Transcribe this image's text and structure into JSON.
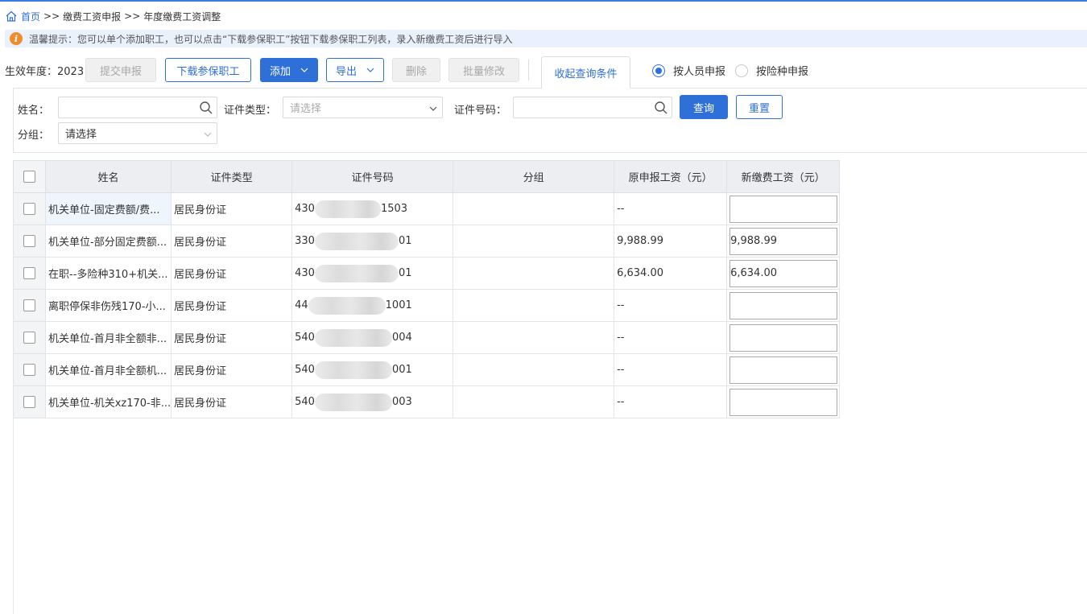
{
  "breadcrumb": {
    "home": "首页",
    "sep1": ">>",
    "level1": "缴费工资申报",
    "sep2": ">>",
    "current": "年度缴费工资调整"
  },
  "tip": {
    "text": "温馨提示：您可以单个添加职工，也可以点击“下载参保职工”按钮下载参保职工列表，录入新缴费工资后进行导入"
  },
  "toolbar": {
    "year_label": "生效年度：",
    "year_value": "2023",
    "submit_label": "提交申报",
    "download_label": "下载参保职工",
    "add_label": "添加",
    "export_label": "导出",
    "delete_label": "删除",
    "batch_edit_label": "批量修改",
    "collapse_label": "收起查询条件",
    "radio_by_person": "按人员申报",
    "radio_by_insurance": "按险种申报",
    "selected_mode": "by_person"
  },
  "query": {
    "name_label": "姓名：",
    "name_value": "",
    "id_type_label": "证件类型：",
    "id_type_placeholder": "请选择",
    "id_no_label": "证件号码：",
    "id_no_value": "",
    "search_label": "查询",
    "reset_label": "重置",
    "group_label": "分组：",
    "group_value": "请选择"
  },
  "table": {
    "columns": [
      "姓名",
      "证件类型",
      "证件号码",
      "分组",
      "原申报工资（元）",
      "新缴费工资（元）"
    ],
    "rows": [
      {
        "name": "机关单位-固定费额/费...",
        "id_type": "居民身份证",
        "id_prefix": "430",
        "id_suffix": "1503",
        "group": "",
        "orig_wage": "--",
        "new_wage": ""
      },
      {
        "name": "机关单位-部分固定费额...",
        "id_type": "居民身份证",
        "id_prefix": "330",
        "id_suffix": "01",
        "group": "",
        "orig_wage": "9,988.99",
        "new_wage": "9,988.99"
      },
      {
        "name": "在职--多险种310+机关...",
        "id_type": "居民身份证",
        "id_prefix": "430",
        "id_suffix": "01",
        "group": "",
        "orig_wage": "6,634.00",
        "new_wage": "6,634.00"
      },
      {
        "name": "离职停保非伤残170-小...",
        "id_type": "居民身份证",
        "id_prefix": "44",
        "id_suffix": "1001",
        "group": "",
        "orig_wage": "--",
        "new_wage": ""
      },
      {
        "name": "机关单位-首月非全额非...",
        "id_type": "居民身份证",
        "id_prefix": "540",
        "id_suffix": "004",
        "group": "",
        "orig_wage": "--",
        "new_wage": ""
      },
      {
        "name": "机关单位-首月非全额机...",
        "id_type": "居民身份证",
        "id_prefix": "540",
        "id_suffix": "001",
        "group": "",
        "orig_wage": "--",
        "new_wage": ""
      },
      {
        "name": "机关单位-机关xz170-非...",
        "id_type": "居民身份证",
        "id_prefix": "540",
        "id_suffix": "003",
        "group": "",
        "orig_wage": "--",
        "new_wage": ""
      }
    ]
  },
  "colors": {
    "accent": "#2f6fd8",
    "tip_bg": "#e8f1fc",
    "tip_icon": "#f08c2e"
  }
}
